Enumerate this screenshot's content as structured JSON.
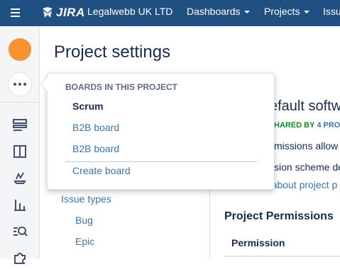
{
  "topbar": {
    "logo_text": "JIRA",
    "org_name": "Legalwebb UK LTD",
    "dashboards_label": "Dashboards",
    "projects_label": "Projects",
    "issues_label": "Issu"
  },
  "page": {
    "title": "Project settings"
  },
  "dropdown": {
    "heading": "BOARDS IN THIS PROJECT",
    "items": [
      {
        "label": "Scrum"
      },
      {
        "label": "B2B board"
      },
      {
        "label": "B2B board"
      }
    ],
    "create_label": "Create board"
  },
  "leftnav": {
    "issue_types_label": "Issue types",
    "bug_label": "Bug",
    "epic_label": "Epic"
  },
  "scheme": {
    "title": "efault softw",
    "shared_prefix": "HARED BY ",
    "shared_projects": "4 PRO",
    "desc1": "missions allow y",
    "desc2": "sion scheme de",
    "learn_more": "e about project p"
  },
  "permissions": {
    "section_title": "Project Permissions",
    "column_permission": "Permission"
  },
  "colors": {
    "header_bg": "#205081",
    "link": "#3b73af",
    "shared_green": "#14892c"
  }
}
